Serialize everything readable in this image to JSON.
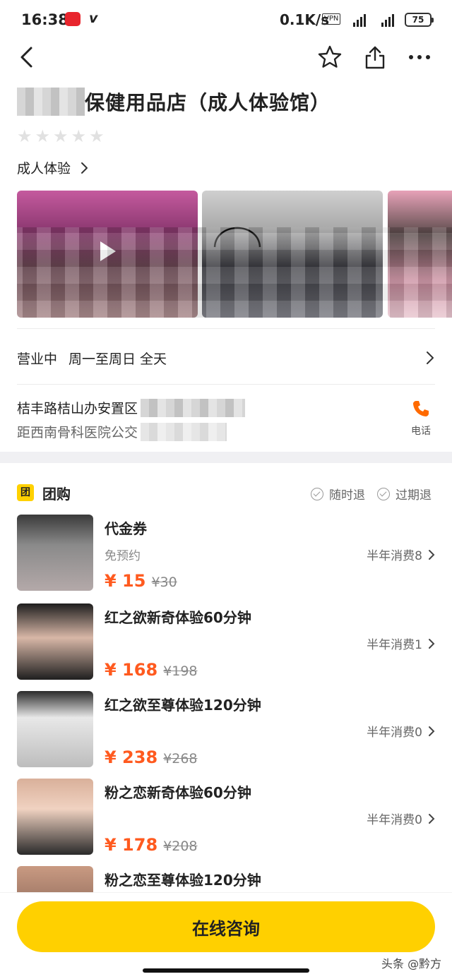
{
  "status_bar": {
    "time": "16:38",
    "network_speed": "0.1K/s",
    "vpn": "VPN",
    "battery": "75"
  },
  "nav": {
    "back_icon": "chevron-left-icon",
    "favorite_icon": "star-outline-icon",
    "share_icon": "share-icon",
    "more_icon": "more-dots-icon"
  },
  "shop": {
    "name": "保健用品店（成人体验馆）",
    "rating_stars": 0,
    "category": "成人体验",
    "hours_status": "营业中",
    "hours": "周一至周日 全天",
    "address_line1": "桔丰路桔山办安置区",
    "address_line2": "距西南骨科医院公交",
    "phone_label": "电话"
  },
  "tuangou": {
    "title": "团购",
    "icon_label": "团",
    "tag_refund_anytime": "随时退",
    "tag_refund_expired": "过期退",
    "deals": [
      {
        "title": "代金券",
        "subtitle": "免预约",
        "sold": "半年消费8",
        "price": "¥ 15",
        "original_price": "¥30"
      },
      {
        "title": "红之欲新奇体验60分钟",
        "subtitle": "",
        "sold": "半年消费1",
        "price": "¥ 168",
        "original_price": "¥198"
      },
      {
        "title": "红之欲至尊体验120分钟",
        "subtitle": "",
        "sold": "半年消费0",
        "price": "¥ 238",
        "original_price": "¥268"
      },
      {
        "title": "粉之恋新奇体验60分钟",
        "subtitle": "",
        "sold": "半年消费0",
        "price": "¥ 178",
        "original_price": "¥208"
      },
      {
        "title": "粉之恋至尊体验120分钟",
        "subtitle": "",
        "sold": "",
        "price": "",
        "original_price": ""
      }
    ]
  },
  "bottom": {
    "consult_button": "在线咨询",
    "watermark": "头条 @黔方"
  },
  "colors": {
    "accent_yellow": "#ffd000",
    "price_orange": "#ff5a1f",
    "phone_orange": "#ff6a00"
  }
}
